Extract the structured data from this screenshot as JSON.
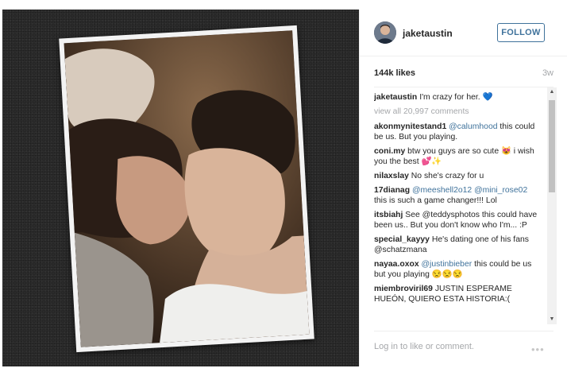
{
  "post": {
    "username": "jaketaustin",
    "follow_label": "FOLLOW",
    "likes": "144k likes",
    "age": "3w",
    "caption_user": "jaketaustin",
    "caption_text": "I'm crazy for her. 💙",
    "view_all": "view all 20,997 comments",
    "login_text": "Log in to like or comment.",
    "more_icon": "more-dots-icon"
  },
  "comments": [
    {
      "user": "akonmynitestand1",
      "mention": "@calumhood",
      "text": " this could be us. But you playing."
    },
    {
      "user": "coni.my",
      "mention": "",
      "text": "btw you guys are so cute 😻 i wish you the best 💕✨"
    },
    {
      "user": "nilaxslay",
      "mention": "",
      "text": "No she's crazy for u"
    },
    {
      "user": "17dianag",
      "mention": "@meeshell2o12 @mini_rose02",
      "text": " this is such a game changer!!! Lol"
    },
    {
      "user": "itsbiahj",
      "mention": "",
      "text": "See @teddysphotos this could have been us.. But you don't know who I'm... :P"
    },
    {
      "user": "special_kayyy",
      "mention": "",
      "text": "He's dating one of his fans @schatzmana"
    },
    {
      "user": "nayaa.oxox",
      "mention": "@justinbieber",
      "text": " this could be us but you playing 😒😒😒"
    },
    {
      "user": "miembroviril69",
      "mention": "",
      "text": "JUSTIN ESPERAME HUEÓN, QUIERO ESTA HISTORIA:("
    }
  ],
  "colors": {
    "accent": "#3f729b",
    "muted": "#a5a7aa",
    "text": "#262626",
    "photo_bg": "#2b2b2b"
  }
}
